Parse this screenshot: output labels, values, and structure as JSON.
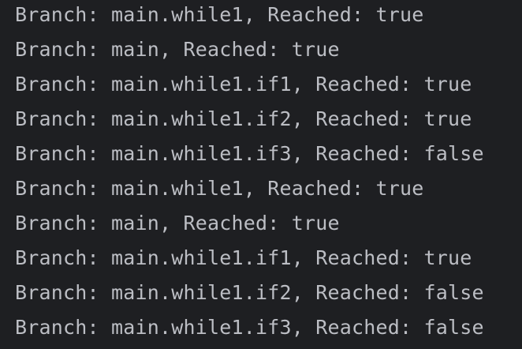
{
  "console": {
    "lines": [
      "Branch: main.while1, Reached: true",
      "Branch: main, Reached: true",
      "Branch: main.while1.if1, Reached: true",
      "Branch: main.while1.if2, Reached: true",
      "Branch: main.while1.if3, Reached: false",
      "Branch: main.while1, Reached: true",
      "Branch: main, Reached: true",
      "Branch: main.while1.if1, Reached: true",
      "Branch: main.while1.if2, Reached: false",
      "Branch: main.while1.if3, Reached: false"
    ]
  },
  "colors": {
    "background": "#1e1f22",
    "text": "#bcbec4"
  }
}
